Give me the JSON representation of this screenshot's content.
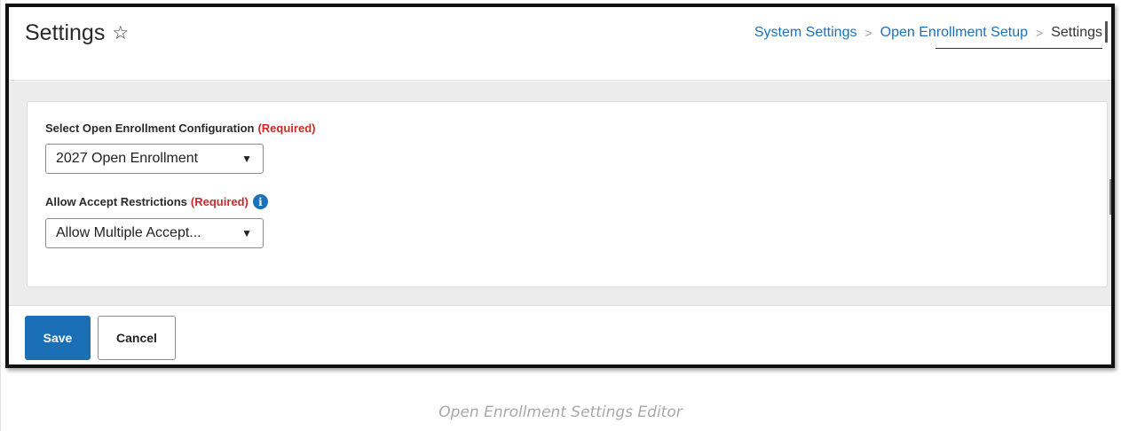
{
  "header": {
    "title": "Settings",
    "favorite_icon": "☆",
    "breadcrumb": [
      "System Settings",
      "Open Enrollment Setup",
      "Settings"
    ],
    "breadcrumb_separator": ">"
  },
  "form": {
    "configuration": {
      "label": "Select Open Enrollment Configuration",
      "required": "(Required)",
      "value": "2027 Open Enrollment"
    },
    "accept_restrictions": {
      "label": "Allow Accept Restrictions",
      "required": "(Required)",
      "info_icon": "i",
      "value": "Allow Multiple Accept..."
    }
  },
  "footer": {
    "save_label": "Save",
    "cancel_label": "Cancel"
  },
  "caption": "Open Enrollment Settings Editor",
  "colors": {
    "link": "#1d71b8",
    "required": "#cc2a2a",
    "primary_button": "#1b6fb7",
    "content_background": "#ececec"
  },
  "icons": {
    "favorite": "star-outline-icon",
    "breadcrumb_separator": "chevron-right-icon",
    "dropdown": "caret-down-icon",
    "info": "info-circle-icon"
  }
}
